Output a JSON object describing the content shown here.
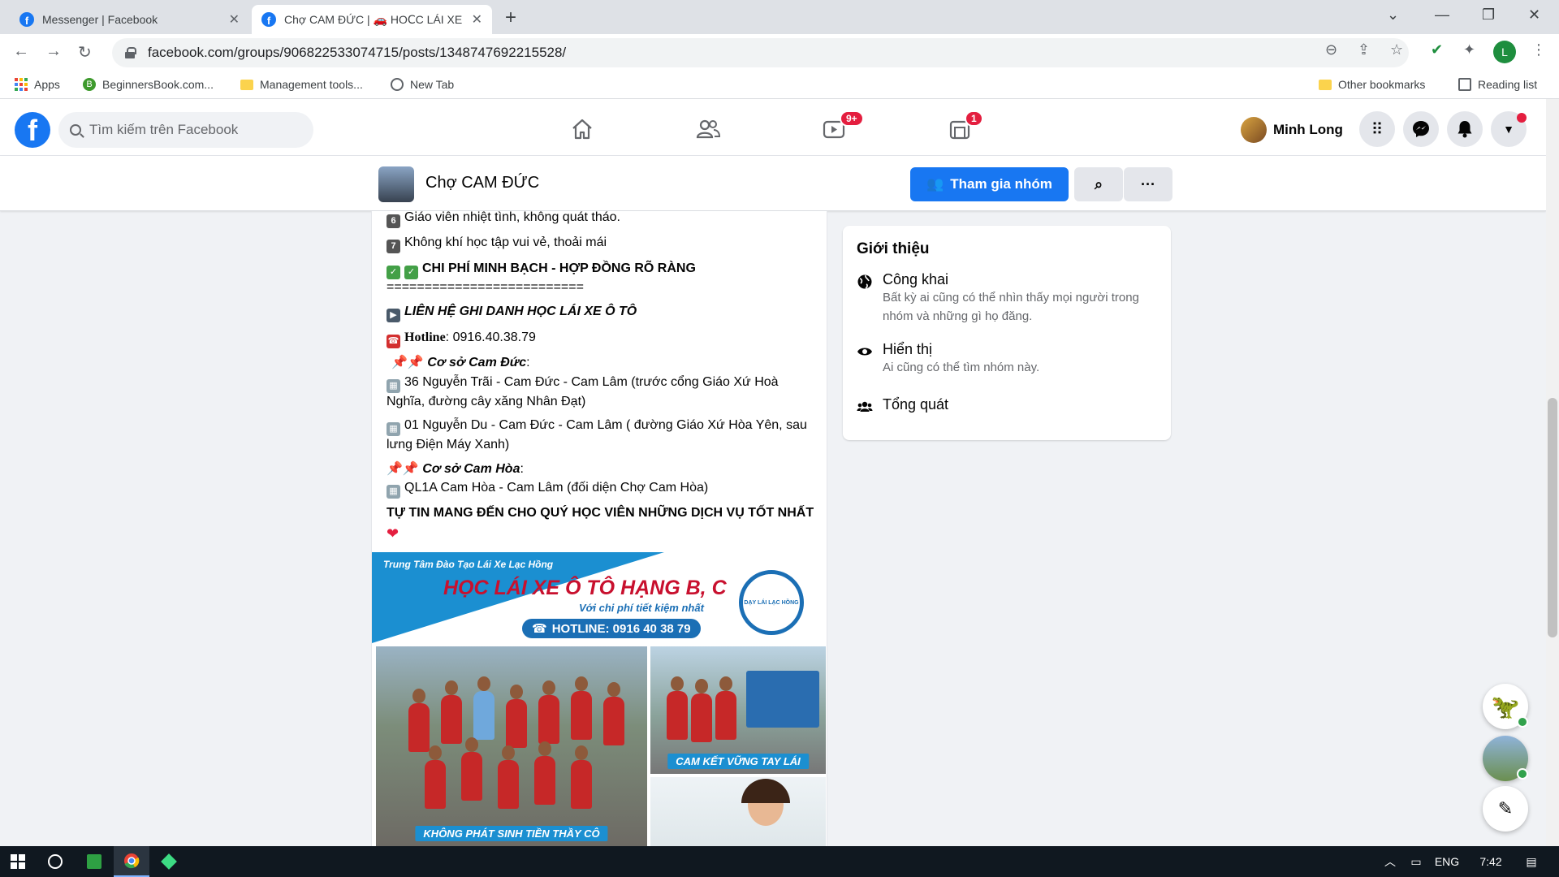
{
  "browser": {
    "tabs": [
      {
        "title": "Messenger | Facebook",
        "active": false
      },
      {
        "title": "Chợ CAM ĐỨC | 🚗 HOⅭC LÁI XE",
        "active": true
      }
    ],
    "url": "facebook.com/groups/906822533074715/posts/1348747692215528/",
    "profile_initial": "L",
    "bookmarks": [
      "Apps",
      "BeginnersBook.com...",
      "Management tools...",
      "New Tab"
    ],
    "other_bookmarks": "Other bookmarks",
    "reading_list": "Reading list"
  },
  "facebook": {
    "search_placeholder": "Tìm kiếm trên Facebook",
    "watch_badge": "9+",
    "groups_badge": "1",
    "user_name": "Minh Long"
  },
  "group": {
    "name": "Chợ CAM ĐỨC",
    "join_label": "Tham gia nhóm",
    "more_label": "···"
  },
  "post": {
    "lines": {
      "l1_num": "6",
      "l1": "Giáo viên nhiệt tình, không quát tháo.",
      "l2_num": "7",
      "l2": "Không khí học tập vui vẻ, thoải mái",
      "l3": "CHI PHÍ MINH BẠCH - HỢP ĐỒNG RÕ RÀNG",
      "l4": "==========================",
      "l5": "LIÊN HỆ GHI DANH HỌC LÁI XE Ô TÔ",
      "l6_label": "Hotline",
      "l6_value": ": 0916.40.38.79",
      "l7": "Cơ sở Cam Đức",
      "l8": "36 Nguyễn Trãi - Cam Đức - Cam Lâm (trước cổng Giáo Xứ Hoà Nghĩa, đường cây xăng Nhân Đạt)",
      "l9": "01 Nguyễn Du - Cam Đức - Cam Lâm ( đường Giáo Xứ Hòa Yên, sau lưng Điện Máy Xanh)",
      "l10": "Cơ sở Cam Hòa",
      "l11": "QL1A Cam Hòa - Cam Lâm (đối diện Chợ Cam Hòa)",
      "l12": "TỰ TIN MANG ĐẾN CHO QUÝ HỌC VIÊN NHỮNG DỊCH VỤ TỐT NHẤT"
    },
    "banner": {
      "subtitle": "Trung Tâm Đào Tạo Lái Xe Lạc Hồng",
      "title": "HỌC LÁI XE Ô TÔ HẠNG B, C",
      "tagline": "Với chi phí tiết kiệm nhất",
      "hotline": "HOTLINE: 0916 40 38 79",
      "logo_text": "DẠY LÁI LẠC HỒNG",
      "caption_left": "KHÔNG PHÁT SINH TIỀN THẦY CÔ",
      "caption_right": "CAM KẾT VỮNG TAY LÁI"
    }
  },
  "intro": {
    "heading": "Giới thiệu",
    "public_title": "Công khai",
    "public_desc": "Bất kỳ ai cũng có thể nhìn thấy mọi người trong nhóm và những gì họ đăng.",
    "visible_title": "Hiển thị",
    "visible_desc": "Ai cũng có thể tìm nhóm này.",
    "general_title": "Tổng quát"
  },
  "taskbar": {
    "language": "ENG",
    "time": "7:42"
  },
  "colors": {
    "facebook_blue": "#1877f2",
    "badge_red": "#e41e3f",
    "banner_blue": "#1b8fd1",
    "banner_red": "#c8102e"
  }
}
